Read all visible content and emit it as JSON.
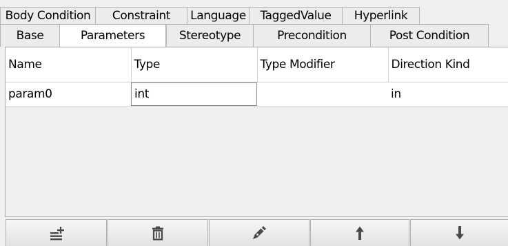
{
  "tabs_row1": [
    {
      "label": "Body Condition"
    },
    {
      "label": "Constraint"
    },
    {
      "label": "Language"
    },
    {
      "label": "TaggedValue"
    },
    {
      "label": "Hyperlink"
    }
  ],
  "tabs_row2": [
    {
      "label": "Base"
    },
    {
      "label": "Parameters"
    },
    {
      "label": "Stereotype"
    },
    {
      "label": "Precondition"
    },
    {
      "label": "Post Condition"
    }
  ],
  "active_tab": "Parameters",
  "table": {
    "columns": [
      "Name",
      "Type",
      "Type Modifier",
      "Direction Kind"
    ],
    "rows": [
      {
        "name": "param0",
        "type": "int",
        "type_modifier": "",
        "direction_kind": "in"
      }
    ]
  },
  "toolbar": {
    "buttons": [
      {
        "icon": "add-row-icon"
      },
      {
        "icon": "trash-icon"
      },
      {
        "icon": "pen-icon"
      },
      {
        "icon": "arrow-up-icon"
      },
      {
        "icon": "arrow-down-icon"
      }
    ]
  },
  "colors": {
    "icon": "#4a4a4a",
    "border": "#b5b5b5",
    "background": "#f0f0f0"
  }
}
